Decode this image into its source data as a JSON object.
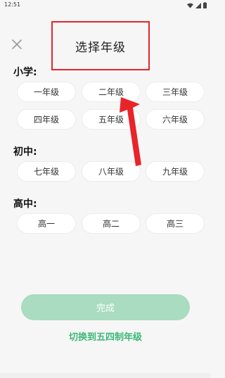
{
  "status_bar": {
    "time": "12:51"
  },
  "header": {
    "title": "选择年级",
    "highlight_color": "#e8242b"
  },
  "sections": [
    {
      "label": "小学:",
      "grades": [
        "一年级",
        "二年级",
        "三年级",
        "四年级",
        "五年级",
        "六年级"
      ]
    },
    {
      "label": "初中:",
      "grades": [
        "七年级",
        "八年级",
        "九年级"
      ]
    },
    {
      "label": "高中:",
      "grades": [
        "高一",
        "高二",
        "高三"
      ]
    }
  ],
  "footer": {
    "done_label": "完成",
    "switch_label": "切换到五四制年级"
  },
  "colors": {
    "accent": "#3db877",
    "done_button": "#a9dcc0",
    "annotation": "#e8242b"
  }
}
